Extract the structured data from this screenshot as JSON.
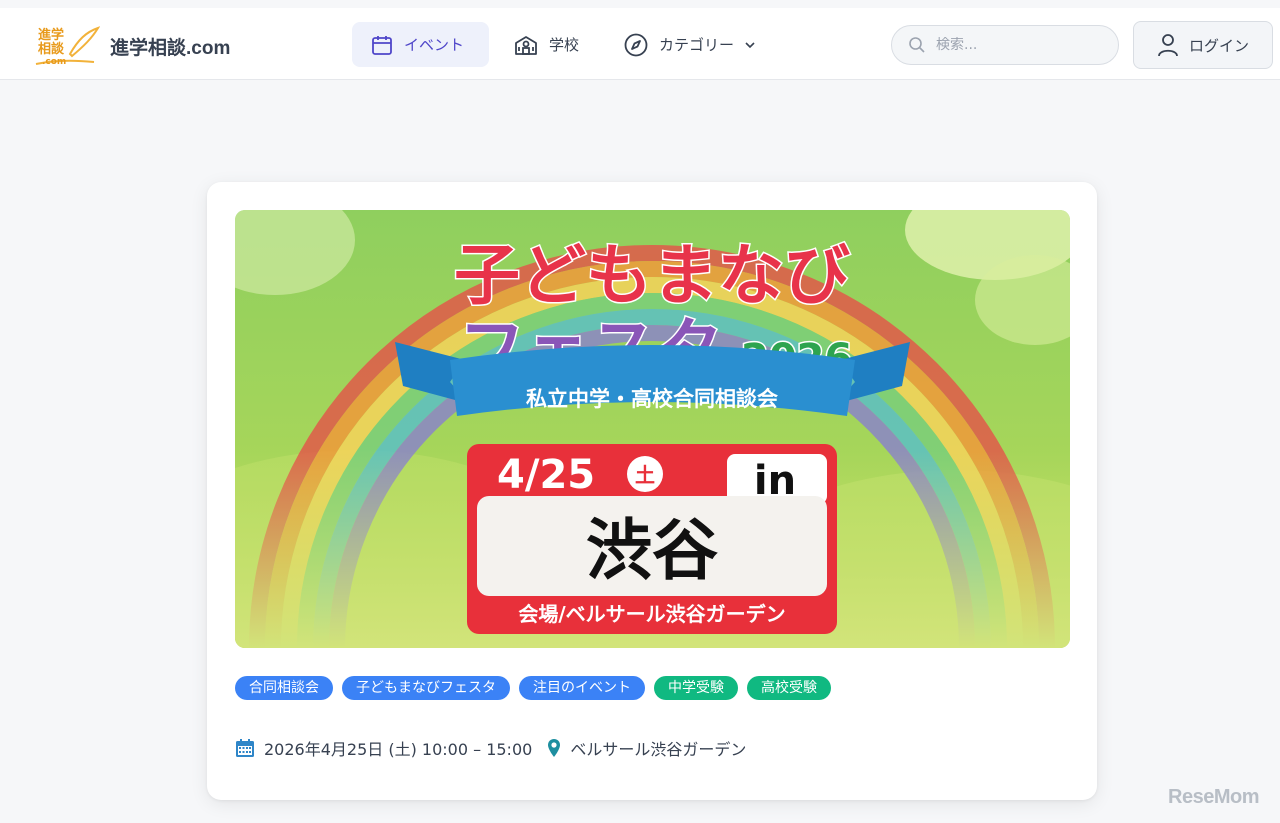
{
  "header": {
    "logo_mark_lines": [
      "進学",
      "相談",
      ".com"
    ],
    "logo_text": "進学相談.com",
    "nav": [
      {
        "label": "イベント",
        "icon": "calendar-icon",
        "active": true
      },
      {
        "label": "学校",
        "icon": "school-icon",
        "active": false
      },
      {
        "label": "カテゴリー",
        "icon": "compass-icon",
        "active": false
      }
    ],
    "search_placeholder": "検索...",
    "login_label": "ログイン"
  },
  "event": {
    "banner": {
      "title_line1": "子どもまなび",
      "title_line2": "フェスタ",
      "year": "2026",
      "subtitle": "私立中学・高校合同相談会",
      "date": "4/25",
      "weekday": "土",
      "in_label": "in",
      "place": "渋谷",
      "venue": "会場/ベルサール渋谷ガーデン"
    },
    "tags": [
      {
        "label": "合同相談会",
        "color": "#3b82f6"
      },
      {
        "label": "子どもまなびフェスタ",
        "color": "#3b82f6"
      },
      {
        "label": "注目のイベント",
        "color": "#3b82f6"
      },
      {
        "label": "中学受験",
        "color": "#10b981"
      },
      {
        "label": "高校受験",
        "color": "#10b981"
      }
    ],
    "datetime": "2026年4月25日 (土) 10:00 – 15:00",
    "location": "ベルサール渋谷ガーデン"
  },
  "watermark": "ReseMom",
  "colors": {
    "accent": "#4f46c9",
    "tag_blue": "#3b82f6",
    "tag_green": "#10b981",
    "banner_red": "#e8303a",
    "banner_ribbon": "#2a8fd0"
  }
}
